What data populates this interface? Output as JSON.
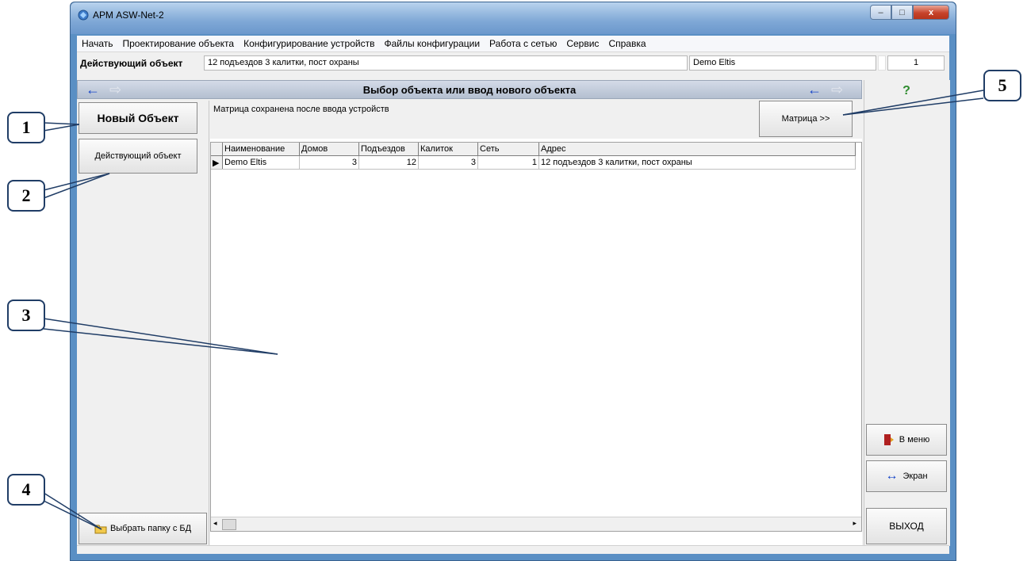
{
  "window": {
    "title": "АРМ ASW-Net-2",
    "controls": {
      "minimize": "–",
      "maximize": "□",
      "close": "x"
    }
  },
  "menu": [
    "Начать",
    "Проектирование объекта",
    "Конфигурирование устройств",
    "Файлы конфигурации",
    "Работа с сетью",
    "Сервис",
    "Справка"
  ],
  "infobar": {
    "label": "Действующий объект",
    "object_description": "12 подъездов 3 калитки, пост охраны",
    "object_name": "Demo Eltis",
    "extra": "",
    "counter": "1"
  },
  "header": {
    "title": "Выбор объекта или ввод нового объекта",
    "left_back": "←",
    "left_forward": "⇨",
    "right_back": "←",
    "right_forward": "⇨"
  },
  "buttons": {
    "new_object": "Новый Объект",
    "current_object": "Действующий объект",
    "select_db_folder": "Выбрать папку с БД",
    "matrix": "Матрица >>",
    "help": "?",
    "to_menu": "В меню",
    "screen": "Экран",
    "exit": "ВЫХОД"
  },
  "message": "Матрица сохранена после ввода устройств",
  "table": {
    "columns": [
      "Наименование",
      "Домов",
      "Подъездов",
      "Калиток",
      "Сеть",
      "Адрес"
    ],
    "rows": [
      [
        "Demo Eltis",
        "3",
        "12",
        "3",
        "1",
        "12 подъездов 3 калитки, пост охраны"
      ]
    ]
  },
  "callouts": [
    "1",
    "2",
    "3",
    "4",
    "5"
  ],
  "colors": {
    "accent_arrow": "#1746c8",
    "callout_border": "#203d66",
    "window_frame": "#5a8fc4"
  }
}
